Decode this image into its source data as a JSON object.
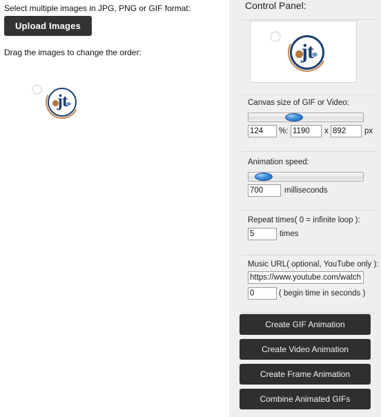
{
  "left_pane": {
    "upload_instruction": "Select multiple images in JPG, PNG or GIF format:",
    "upload_button_label": "Upload Images",
    "drag_instruction": "Drag the images to change the order:",
    "thumbnail": {
      "alt": "jt-logo-thumbnail",
      "glyph": "jt"
    }
  },
  "control_panel": {
    "title": "Control Panel:",
    "preview": {
      "alt": "jt-logo-preview",
      "glyph": "jt"
    },
    "canvas_size": {
      "label": "Canvas size of GIF or Video:",
      "percent_value": "124",
      "percent_unit": "%:",
      "width_value": "1190",
      "separator": "x",
      "height_value": "892",
      "px_unit": "px",
      "slider_position_pct": 38
    },
    "animation_speed": {
      "label": "Animation speed:",
      "value": "700",
      "unit": "milliseconds",
      "slider_position_pct": 6
    },
    "repeat_times": {
      "label": "Repeat times( 0 = infinite loop ):",
      "value": "5",
      "unit": "times"
    },
    "music": {
      "label": "Music URL( optional, YouTube only ):",
      "url_value": "https://www.youtube.com/watch?v=",
      "begin_time_value": "0",
      "begin_time_hint": "( begin time in seconds )"
    },
    "actions": [
      {
        "id": "create-gif-animation",
        "label": "Create GIF Animation"
      },
      {
        "id": "create-video-animation",
        "label": "Create Video Animation"
      },
      {
        "id": "create-frame-animation",
        "label": "Create Frame Animation"
      },
      {
        "id": "combine-animated-gifs",
        "label": "Combine Animated GIFs"
      }
    ]
  },
  "colors": {
    "panel_background": "#efefef",
    "button_dark": "#2f2f2f",
    "upload_button_dark": "#333333",
    "logo_navy": "#1c3f6e",
    "logo_copper": "#b4763f",
    "slider_blue": "#1c63ba"
  }
}
